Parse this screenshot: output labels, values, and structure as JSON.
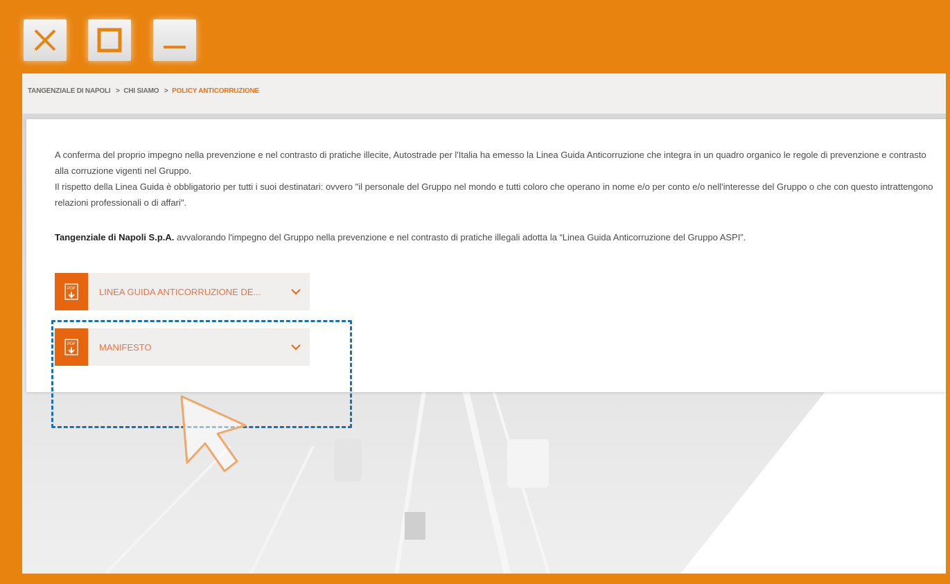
{
  "window_controls": {
    "close": "close-icon",
    "maximize": "maximize-icon",
    "minimize": "minimize-icon"
  },
  "breadcrumb": {
    "items": [
      "TANGENZIALE DI NAPOLI",
      "CHI SIAMO",
      "POLICY ANTICORRUZIONE"
    ],
    "separator": ">"
  },
  "content": {
    "paragraph1": "A conferma del proprio impegno nella prevenzione e nel contrasto di pratiche illecite, Autostrade per l'Italia ha emesso la Linea Guida Anticorruzione che integra in un quadro organico le regole di prevenzione e contrasto alla corruzione vigenti nel Gruppo.",
    "paragraph2": "Il rispetto della Linea Guida è obbligatorio per tutti i suoi destinatari: ovvero \"il personale del Gruppo nel mondo e tutti coloro che operano in nome e/o per conto e/o nell'interesse del Gruppo o che con questo intrattengono relazioni professionali o di affari\".",
    "paragraph3_bold": "Tangenziale di Napoli S.p.A.",
    "paragraph3_rest": " avvalorando l'impegno del Gruppo nella prevenzione e nel contrasto di pratiche illegali adotta la “Linea  Guida  Anticorruzione del Gruppo  ASPI”."
  },
  "accordions": [
    {
      "label": "LINEA GUIDA ANTICORRUZIONE DE...",
      "icon": "pdf-download-icon"
    },
    {
      "label": "MANIFESTO",
      "icon": "pdf-download-icon"
    }
  ],
  "colors": {
    "frame_orange": "#e8830f",
    "accent": "#e8650f",
    "highlight_border": "#1b6fb3"
  }
}
